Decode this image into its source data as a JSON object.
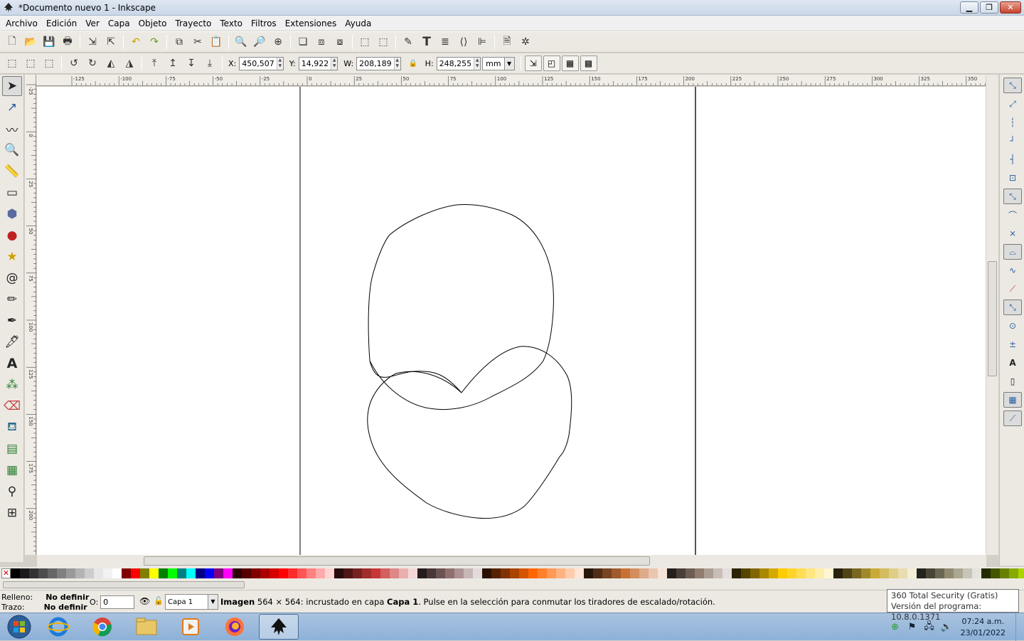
{
  "window": {
    "title": "*Documento nuevo 1 - Inkscape"
  },
  "menu": [
    {
      "label": "Archivo"
    },
    {
      "label": "Edición"
    },
    {
      "label": "Ver"
    },
    {
      "label": "Capa"
    },
    {
      "label": "Objeto"
    },
    {
      "label": "Trayecto"
    },
    {
      "label": "Texto"
    },
    {
      "label": "Filtros"
    },
    {
      "label": "Extensiones"
    },
    {
      "label": "Ayuda"
    }
  ],
  "selector": {
    "x_label": "X:",
    "x": "450,507",
    "y_label": "Y:",
    "y": "14,922",
    "w_label": "W:",
    "w": "208,189",
    "h_label": "H:",
    "h": "248,255",
    "unit": "mm"
  },
  "ruler_h_ticks": [
    "-125",
    "-100",
    "-75",
    "-50",
    "-25",
    "0",
    "25",
    "50",
    "75",
    "100",
    "125",
    "150",
    "175",
    "200",
    "225",
    "250",
    "275",
    "300",
    "325",
    "350"
  ],
  "ruler_v_ticks": [
    "-25",
    "0",
    "25",
    "50",
    "75",
    "100",
    "125",
    "150",
    "175",
    "200",
    "225",
    "250",
    "275"
  ],
  "status": {
    "fill_label": "Relleno:",
    "fill_value": "No definir",
    "stroke_label": "Trazo:",
    "stroke_value": "No definir",
    "opacity_label": "O:",
    "opacity_value": "0",
    "layer": "Capa 1",
    "msg_bold1": "Imagen",
    "msg_part1": " 564 × 564: incrustado en capa ",
    "msg_bold2": "Capa 1",
    "msg_part2": ". Pulse en la selección para conmutar los tiradores de escalado/rotación."
  },
  "tooltip": {
    "line1": "360 Total Security (Gratis)",
    "line2": "Versión del programa: 10.8.0.1371"
  },
  "clock": {
    "time": "07:24 a.m.",
    "date": "23/01/2022"
  },
  "palette_colors": [
    "#000000",
    "#1a1a1a",
    "#333333",
    "#4d4d4d",
    "#666666",
    "#808080",
    "#999999",
    "#b3b3b3",
    "#cccccc",
    "#e6e6e6",
    "#f2f2f2",
    "#ffffff",
    "#800000",
    "#ff0000",
    "#808000",
    "#ffff00",
    "#008000",
    "#00ff00",
    "#008080",
    "#00ffff",
    "#000080",
    "#0000ff",
    "#800080",
    "#ff00ff",
    "#2b0000",
    "#550000",
    "#800000",
    "#aa0000",
    "#d40000",
    "#ff0000",
    "#ff2a2a",
    "#ff5555",
    "#ff8080",
    "#ffaaaa",
    "#ffd5d5",
    "#280b0b",
    "#501616",
    "#782121",
    "#a02c2c",
    "#c83737",
    "#d35f5f",
    "#de8787",
    "#e9afaf",
    "#f4d7d7",
    "#241c1c",
    "#483737",
    "#6c5353",
    "#916f6f",
    "#ac9393",
    "#c8b7b7",
    "#e3dbdb",
    "#2b1100",
    "#552200",
    "#803300",
    "#aa4400",
    "#d45500",
    "#ff6600",
    "#ff7f2a",
    "#ff9955",
    "#ffb380",
    "#ffccaa",
    "#ffe6d5",
    "#28170b",
    "#502d16",
    "#784421",
    "#a05a2c",
    "#c87137",
    "#d38d5f",
    "#deaa87",
    "#e9c6af",
    "#f4e3d7",
    "#241f1c",
    "#483e37",
    "#6c5d53",
    "#917c6f",
    "#ac9d93",
    "#c8beb7",
    "#e3dedb",
    "#2b2200",
    "#554400",
    "#806600",
    "#aa8800",
    "#d4aa00",
    "#ffcc00",
    "#ffd42a",
    "#ffdd55",
    "#ffe680",
    "#ffeeaa",
    "#fff6d5",
    "#28220b",
    "#504416",
    "#786721",
    "#a0892c",
    "#c8ab37",
    "#d3bc5f",
    "#decd87",
    "#e9ddaf",
    "#f4eed7",
    "#24221c",
    "#484537",
    "#6c6753",
    "#918a6f",
    "#aca793",
    "#c8c4b7",
    "#e3e2db",
    "#222b00",
    "#445500",
    "#668000",
    "#88aa00",
    "#aad400",
    "#ccff00",
    "#d4ff2a",
    "#ddff55",
    "#e5ff80",
    "#eeffaa",
    "#f6ffd5",
    "#1e280b",
    "#3c5016",
    "#5a7821",
    "#78a02c",
    "#96c837",
    "#abd35f",
    "#c1de87",
    "#d6e9af",
    "#ebf4d7",
    "#1f241c",
    "#3e4837",
    "#5d6c53",
    "#7c916f",
    "#9dac93",
    "#bec8b7",
    "#dee3db",
    "#112b00",
    "#225500",
    "#338000",
    "#44aa00",
    "#55d400",
    "#66ff00",
    "#7fff2a",
    "#99ff55",
    "#b3ff80",
    "#ccffaa",
    "#e5ffd5"
  ],
  "canvas": {
    "page_border_color": "#555555",
    "stroke_color": "#000000"
  }
}
